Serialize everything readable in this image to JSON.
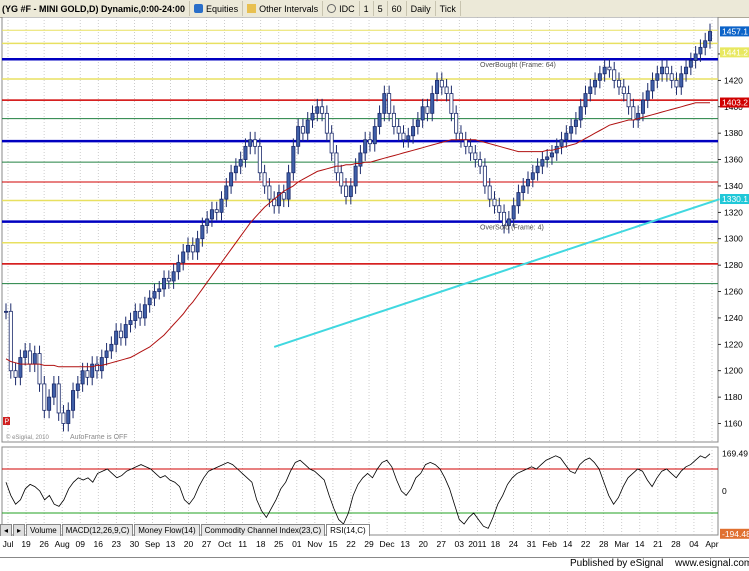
{
  "toolbar": {
    "title": "(YG #F - MINI GOLD,D) Dynamic,0:00-24:00",
    "equities": "Equities",
    "other_intervals": "Other Intervals",
    "idc": "IDC",
    "i1": "1",
    "i5": "5",
    "i60": "60",
    "daily": "Daily",
    "tick": "Tick"
  },
  "tabs": [
    "Volume",
    "MACD(12,26,9,C)",
    "Money Flow(14)",
    "Commodity Channel Index(23,C)",
    "RSI(14,C)"
  ],
  "footer": {
    "publisher": "Published by eSignal",
    "site": "www.esignal.com"
  },
  "annotations": {
    "overbought": "OverBought (Frame: 64)",
    "oversold": "OverSold (Frame: 4)",
    "autoframe": "AutoFrame is OFF",
    "copyright": "© eSignal, 2010",
    "p_marker": "P"
  },
  "chart_data": {
    "type": "line",
    "main": {
      "instrument": "MINI GOLD",
      "y_ticks": [
        1160,
        1180,
        1200,
        1220,
        1240,
        1260,
        1280,
        1300,
        1320,
        1340,
        1360,
        1380,
        1400,
        1420,
        1440
      ],
      "ylim": [
        1146,
        1468
      ],
      "price_labels": [
        {
          "text": "1457.1",
          "value": 1457.1,
          "color": "#0c63c8"
        },
        {
          "text": "1441.2",
          "value": 1441.2,
          "color": "#e8e860"
        },
        {
          "text": "1403.2",
          "value": 1403.2,
          "color": "#d00000"
        },
        {
          "text": "1330.1",
          "value": 1330.1,
          "color": "#20c8d8"
        }
      ],
      "horizontal_levels": [
        {
          "value": 1458,
          "color": "#e8e060",
          "width": 1
        },
        {
          "value": 1448,
          "color": "#e8e060",
          "width": 1.5
        },
        {
          "value": 1436,
          "color": "#0000c0",
          "width": 2.5
        },
        {
          "value": 1421,
          "color": "#e8e060",
          "width": 1.5
        },
        {
          "value": 1405,
          "color": "#d00000",
          "width": 1.5
        },
        {
          "value": 1391,
          "color": "#208040",
          "width": 1
        },
        {
          "value": 1374,
          "color": "#0000c0",
          "width": 2.5
        },
        {
          "value": 1358,
          "color": "#208040",
          "width": 1
        },
        {
          "value": 1343,
          "color": "#d00000",
          "width": 1
        },
        {
          "value": 1329,
          "color": "#e8e060",
          "width": 1.5
        },
        {
          "value": 1313,
          "color": "#0000c0",
          "width": 2.5
        },
        {
          "value": 1297,
          "color": "#e8e060",
          "width": 1.5
        },
        {
          "value": 1281,
          "color": "#d00000",
          "width": 1.5
        },
        {
          "value": 1266,
          "color": "#208040",
          "width": 1
        }
      ],
      "close": [
        1245,
        1200,
        1195,
        1210,
        1215,
        1205,
        1213,
        1190,
        1170,
        1180,
        1190,
        1168,
        1160,
        1170,
        1185,
        1190,
        1200,
        1195,
        1205,
        1200,
        1210,
        1215,
        1220,
        1230,
        1225,
        1235,
        1238,
        1245,
        1240,
        1250,
        1255,
        1260,
        1262,
        1270,
        1268,
        1275,
        1282,
        1290,
        1295,
        1290,
        1300,
        1310,
        1315,
        1322,
        1320,
        1330,
        1340,
        1350,
        1355,
        1360,
        1370,
        1375,
        1370,
        1350,
        1340,
        1330,
        1325,
        1335,
        1330,
        1350,
        1370,
        1385,
        1380,
        1390,
        1395,
        1400,
        1395,
        1380,
        1365,
        1350,
        1340,
        1332,
        1340,
        1355,
        1365,
        1375,
        1372,
        1385,
        1395,
        1410,
        1395,
        1385,
        1380,
        1375,
        1378,
        1385,
        1390,
        1400,
        1395,
        1410,
        1420,
        1415,
        1410,
        1395,
        1380,
        1375,
        1370,
        1365,
        1360,
        1355,
        1340,
        1330,
        1325,
        1320,
        1310,
        1315,
        1325,
        1335,
        1340,
        1345,
        1350,
        1355,
        1360,
        1362,
        1365,
        1370,
        1375,
        1380,
        1385,
        1390,
        1400,
        1410,
        1415,
        1420,
        1425,
        1430,
        1428,
        1420,
        1415,
        1410,
        1400,
        1390,
        1395,
        1405,
        1412,
        1420,
        1425,
        1430,
        1425,
        1420,
        1415,
        1425,
        1430,
        1435,
        1440,
        1445,
        1450,
        1457
      ],
      "ma_red": [
        1209,
        1207,
        1206,
        1205,
        1205,
        1205,
        1205,
        1205,
        1204,
        1204,
        1204,
        1203,
        1203,
        1203,
        1203,
        1203,
        1203,
        1203,
        1203,
        1204,
        1204,
        1205,
        1206,
        1207,
        1208,
        1209,
        1210,
        1212,
        1214,
        1216,
        1218,
        1221,
        1224,
        1227,
        1231,
        1235,
        1239,
        1243,
        1248,
        1252,
        1257,
        1262,
        1267,
        1272,
        1277,
        1282,
        1287,
        1292,
        1297,
        1302,
        1307,
        1312,
        1316,
        1320,
        1324,
        1327,
        1330,
        1333,
        1336,
        1338,
        1340,
        1343,
        1345,
        1347,
        1349,
        1351,
        1352,
        1353,
        1354,
        1355,
        1355,
        1356,
        1356,
        1357,
        1357,
        1358,
        1358,
        1359,
        1360,
        1361,
        1362,
        1363,
        1364,
        1365,
        1366,
        1367,
        1368,
        1369,
        1370,
        1371,
        1372,
        1373,
        1374,
        1375,
        1375,
        1375,
        1375,
        1375,
        1375,
        1374,
        1373,
        1372,
        1371,
        1370,
        1369,
        1368,
        1367,
        1366,
        1366,
        1366,
        1366,
        1366,
        1366,
        1367,
        1367,
        1368,
        1369,
        1370,
        1371,
        1372,
        1374,
        1376,
        1378,
        1380,
        1382,
        1384,
        1386,
        1387,
        1388,
        1389,
        1390,
        1390,
        1391,
        1392,
        1393,
        1394,
        1395,
        1396,
        1397,
        1398,
        1399,
        1400,
        1401,
        1402,
        1403,
        1403,
        1403,
        1403
      ],
      "ma_cyan": {
        "x_start_idx": 56,
        "start": 1218,
        "end": 1330,
        "x_end_idx": 149
      }
    },
    "rsi": {
      "name": "RSI(14,C)",
      "labels": [
        {
          "text": "169.49",
          "color": "#000000"
        },
        {
          "text": "0",
          "color": "#000000"
        },
        {
          "text": "-194.48",
          "color": "#d00000"
        }
      ],
      "values": [
        40,
        -20,
        -60,
        -40,
        10,
        30,
        20,
        0,
        -40,
        -20,
        -60,
        -70,
        -40,
        10,
        40,
        60,
        50,
        60,
        40,
        80,
        90,
        100,
        80,
        60,
        70,
        90,
        100,
        110,
        120,
        110,
        100,
        80,
        60,
        70,
        50,
        40,
        20,
        -40,
        -60,
        -30,
        20,
        60,
        90,
        100,
        110,
        120,
        130,
        120,
        100,
        80,
        60,
        40,
        -40,
        -90,
        -120,
        -80,
        -40,
        10,
        40,
        90,
        130,
        140,
        120,
        100,
        90,
        70,
        50,
        -20,
        -80,
        -130,
        -150,
        -100,
        -20,
        30,
        60,
        80,
        60,
        100,
        130,
        140,
        110,
        50,
        0,
        -20,
        10,
        60,
        80,
        120,
        130,
        120,
        100,
        60,
        10,
        -60,
        -130,
        -150,
        -120,
        -100,
        -130,
        -160,
        -170,
        -120,
        -60,
        -20,
        30,
        60,
        80,
        90,
        100,
        110,
        100,
        120,
        140,
        150,
        160,
        150,
        120,
        90,
        80,
        120,
        140,
        150,
        130,
        100,
        40,
        -20,
        -60,
        -30,
        20,
        60,
        80,
        100,
        90,
        50,
        20,
        60,
        90,
        100,
        80,
        60,
        90,
        110,
        120,
        140,
        160,
        150,
        169
      ]
    },
    "x_labels": [
      "Jul",
      "19",
      "26",
      "Aug",
      "09",
      "16",
      "23",
      "30",
      "Sep",
      "13",
      "20",
      "27",
      "Oct",
      "11",
      "18",
      "25",
      "01",
      "Nov",
      "15",
      "22",
      "29",
      "Dec",
      "13",
      "20",
      "27",
      "03",
      "2011",
      "18",
      "24",
      "31",
      "Feb",
      "14",
      "22",
      "28",
      "Mar",
      "14",
      "21",
      "28",
      "04",
      "Apr"
    ]
  }
}
